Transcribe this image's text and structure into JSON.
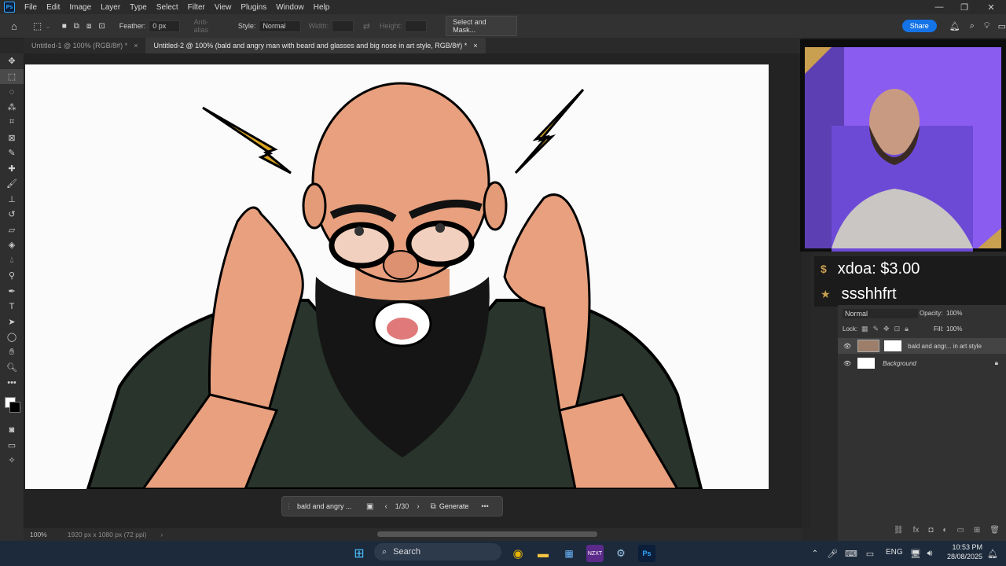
{
  "menu": {
    "app_icon": "Ps",
    "items": [
      "File",
      "Edit",
      "Image",
      "Layer",
      "Type",
      "Select",
      "Filter",
      "View",
      "Plugins",
      "Window",
      "Help"
    ]
  },
  "options": {
    "feather_label": "Feather:",
    "feather_value": "0 px",
    "anti_alias_label": "Anti-alias",
    "style_label": "Style:",
    "style_value": "Normal",
    "width_label": "Width:",
    "height_label": "Height:",
    "select_mask_label": "Select and Mask...",
    "share_label": "Share"
  },
  "tabs": [
    {
      "label": "Untitled-1 @ 100% (RGB/8#) *",
      "close": "×"
    },
    {
      "label": "Untitled-2 @ 100% (bald and angry man with beard and glasses and big nose in art style, RGB/8#) *",
      "close": "×"
    }
  ],
  "context_bar": {
    "prompt_text": "bald and angry ...",
    "page": "1/30",
    "generate_label": "Generate",
    "more": "•••"
  },
  "status": {
    "zoom": "100%",
    "doc_info": "1920 px x 1080 px (72 ppi)",
    "arrow": "›"
  },
  "layers_panel": {
    "blend_mode": "Normal",
    "opacity_label": "Opacity:",
    "opacity_value": "100%",
    "lock_label": "Lock:",
    "fill_label": "Fill:",
    "fill_value": "100%",
    "layers": [
      {
        "name": "bald and angr... in art style"
      },
      {
        "name": "Background"
      }
    ]
  },
  "stream_alerts": [
    {
      "text": "xdoa: $3.00"
    },
    {
      "text": "ssshhfrt"
    }
  ],
  "taskbar": {
    "search_placeholder": "Search",
    "language": "ENG",
    "time": "10:53 PM",
    "date": "28/08/2025",
    "steam_label": "NZXT"
  },
  "colors": {
    "accent": "#1473e6",
    "stream_purple": "#8a5cf0",
    "alert_gold": "#c9a050"
  }
}
